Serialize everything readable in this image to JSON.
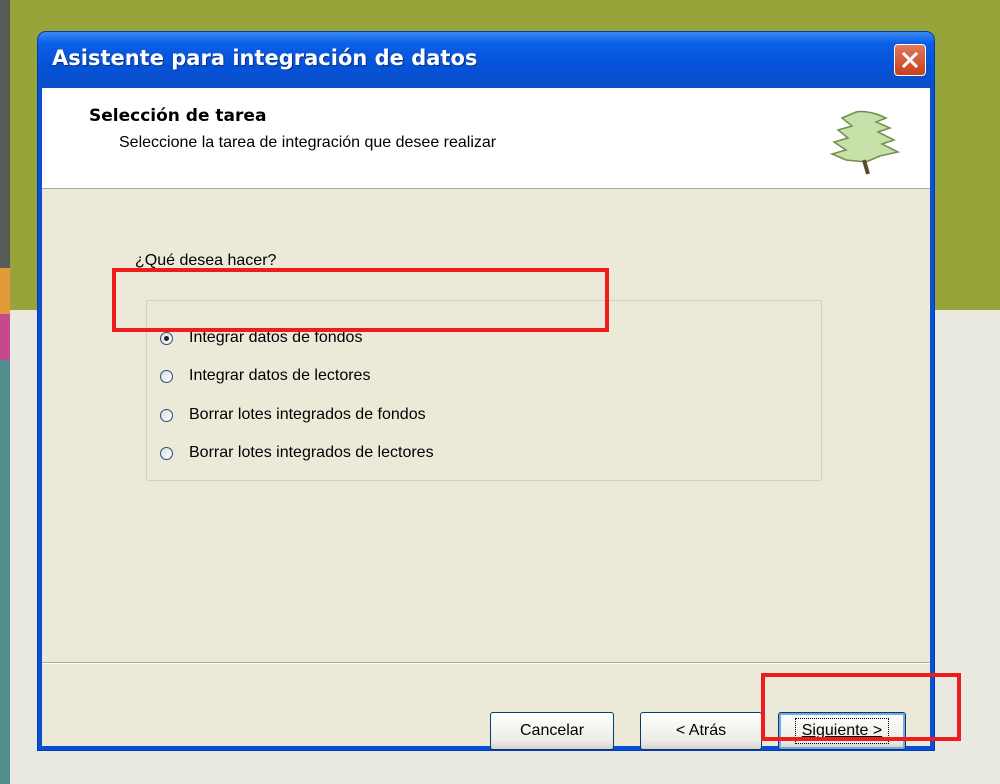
{
  "colors": {
    "titlebar": "#0552d8",
    "client_bg": "#ece9d8",
    "highlight": "#ee1c1c",
    "close_button": "#c9401d"
  },
  "window": {
    "title": "Asistente para integración de datos",
    "close_icon": "close-x-icon"
  },
  "header": {
    "title": "Selección de tarea",
    "subtitle": "Seleccione la tarea de integración que desee realizar",
    "icon": "tree-icon"
  },
  "body": {
    "question": "¿Qué desea hacer?",
    "options": [
      {
        "label": "Integrar datos de fondos",
        "checked": true
      },
      {
        "label": "Integrar datos de lectores",
        "checked": false
      },
      {
        "label": "Borrar lotes integrados de fondos",
        "checked": false
      },
      {
        "label": "Borrar lotes integrados de lectores",
        "checked": false
      }
    ]
  },
  "footer": {
    "cancel_label": "Cancelar",
    "back_label": "< Atrás",
    "next_label": "Siguiente >"
  }
}
